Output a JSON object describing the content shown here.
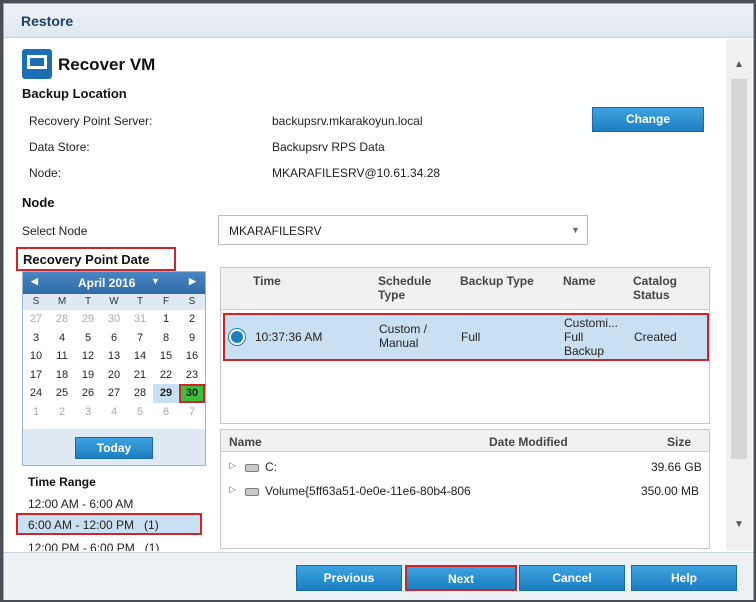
{
  "window": {
    "title": "Restore"
  },
  "header": {
    "title": "Recover VM"
  },
  "backup_location": {
    "heading": "Backup Location",
    "rows": [
      {
        "label": "Recovery Point Server:",
        "value": "backupsrv.mkarakoyun.local"
      },
      {
        "label": "Data Store:",
        "value": "Backupsrv RPS Data"
      },
      {
        "label": "Node:",
        "value": "MKARAFILESRV@10.61.34.28"
      }
    ],
    "change_label": "Change"
  },
  "node": {
    "heading": "Node",
    "select_label": "Select Node",
    "selected": "MKARAFILESRV"
  },
  "recovery_point_date": {
    "heading": "Recovery Point Date",
    "month": "April 2016",
    "days_of_week": [
      "S",
      "M",
      "T",
      "W",
      "T",
      "F",
      "S"
    ],
    "days": [
      "27",
      "28",
      "29",
      "30",
      "31",
      "1",
      "2",
      "3",
      "4",
      "5",
      "6",
      "7",
      "8",
      "9",
      "10",
      "11",
      "12",
      "13",
      "14",
      "15",
      "16",
      "17",
      "18",
      "19",
      "20",
      "21",
      "22",
      "23",
      "24",
      "25",
      "26",
      "27",
      "28",
      "29",
      "30",
      "1",
      "2",
      "3",
      "4",
      "5",
      "6",
      "7"
    ],
    "today_label": "Today"
  },
  "time_range": {
    "heading": "Time Range",
    "items": [
      "12:00 AM - 6:00 AM",
      "6:00 AM - 12:00 PM   (1)",
      "12:00 PM - 6:00 PM   (1)"
    ]
  },
  "recovery_points": {
    "columns": [
      "Time",
      "Schedule Type",
      "Backup Type",
      "Name",
      "Catalog Status"
    ],
    "rows": [
      {
        "time": "10:37:36 AM",
        "schedule": "Custom / Manual",
        "backup_type": "Full",
        "name": "Customi... Full Backup",
        "catalog": "Created"
      }
    ]
  },
  "files": {
    "columns": [
      "Name",
      "Date Modified",
      "Size"
    ],
    "rows": [
      {
        "name": "C:",
        "date": "",
        "size": "39.66 GB"
      },
      {
        "name": "Volume{5ff63a51-0e0e-11e6-80b4-806",
        "date": "",
        "size": "350.00 MB"
      }
    ]
  },
  "footer": {
    "previous": "Previous",
    "next": "Next",
    "cancel": "Cancel",
    "help": "Help"
  },
  "colors": {
    "accent": "#1b7ec2",
    "highlight": "#d2232a",
    "selected_day": "#3cbf3c"
  }
}
